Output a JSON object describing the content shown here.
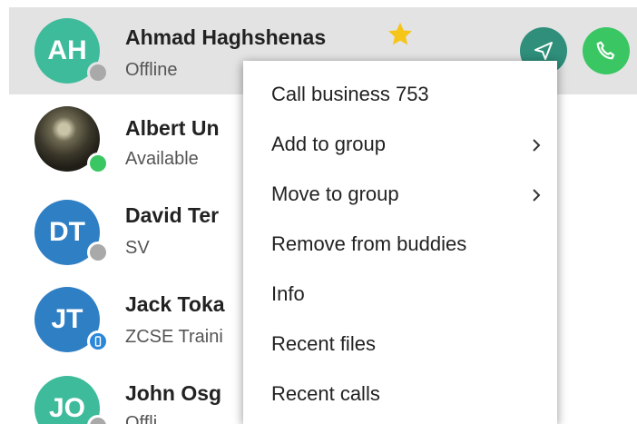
{
  "contacts": [
    {
      "initials": "AH",
      "name": "Ahmad Haghshenas",
      "status": "Offline",
      "avatar_color": "#3dbb9b",
      "presence": "offline",
      "favorite": true
    },
    {
      "initials": "",
      "name": "Albert Un",
      "status": "Available",
      "avatar_color": "#3b3727",
      "presence": "available"
    },
    {
      "initials": "DT",
      "name": "David Ter",
      "status": "SV",
      "avatar_color": "#2f7fc4",
      "presence": "offline"
    },
    {
      "initials": "JT",
      "name": "Jack Toka",
      "status": "ZCSE Traini",
      "avatar_color": "#2f7fc4",
      "presence": "on-phone"
    },
    {
      "initials": "JO",
      "name": "John Osg",
      "status": "Offli",
      "avatar_color": "#3dbb9b",
      "presence": "offline"
    }
  ],
  "row_actions": {
    "message_icon": "send-icon",
    "call_icon": "phone-icon",
    "message_color": "#2f8f7a",
    "call_color": "#3ac763"
  },
  "context_menu": {
    "items": [
      {
        "label": "Call business 753",
        "submenu": false
      },
      {
        "label": "Add to group",
        "submenu": true
      },
      {
        "label": "Move to group",
        "submenu": true
      },
      {
        "label": "Remove from buddies",
        "submenu": false
      },
      {
        "label": "Info",
        "submenu": false
      },
      {
        "label": "Recent files",
        "submenu": false
      },
      {
        "label": "Recent calls",
        "submenu": false
      }
    ]
  },
  "colors": {
    "offline": "#a9a9a9",
    "available": "#3ac763",
    "on_phone": "#2b87d8",
    "favorite_star": "#f5c518",
    "selected_row": "#e3e3e3"
  }
}
